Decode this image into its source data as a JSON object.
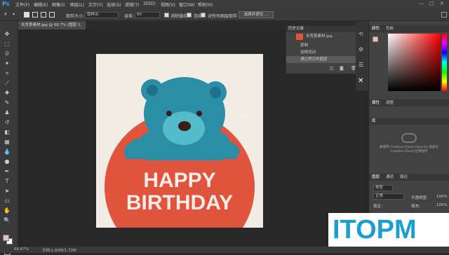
{
  "app": {
    "logo": "Ps"
  },
  "menu": {
    "items": [
      "文件(F)",
      "编辑(E)",
      "图像(I)",
      "图层(L)",
      "文字(Y)",
      "选择(S)",
      "滤镜(T)",
      "3D(D)",
      "视图(V)",
      "窗口(W)",
      "帮助(H)"
    ]
  },
  "window_controls": [
    "—",
    "□",
    "✕"
  ],
  "options": {
    "sample_size_label": "取样大小:",
    "sample_size_value": "取样点",
    "tolerance_label": "容差:",
    "tolerance_value": "60",
    "antialias_label": "消除锯齿",
    "contiguous_label": "连续",
    "sample_all_label": "对所有图层取样",
    "select_mask_button": "选择并遮住 ..."
  },
  "document": {
    "tab_title": "去背景素材.jpg @ 66.7% (图层 1, RGB/8#) *",
    "close": "×"
  },
  "history": {
    "panel_title": "历史记录",
    "snapshot_label": "去背景素材.jpg",
    "items": [
      "复制",
      "选择扭动",
      "通过拷贝的图层"
    ]
  },
  "right_panel": {
    "color_tabs": [
      "颜色",
      "色板"
    ],
    "properties_tabs": [
      "属性",
      "调整"
    ],
    "library_tabs": [
      "库"
    ],
    "cc_message": "要使用 Creative Cloud Libraries,请安装 Creative Cloud 应用程序",
    "layers_tabs": [
      "图层",
      "通道",
      "路径"
    ],
    "filter_kind": "类型",
    "blend_mode": "正常",
    "opacity_label": "不透明度:",
    "opacity_value": "100%",
    "lock_label": "锁定:",
    "fill_label": "填充:",
    "fill_value": "100%"
  },
  "artwork": {
    "line1": "HAPPY",
    "line2": "BIRTHDAY"
  },
  "status": {
    "zoom": "66.67%",
    "doc_size": "文档:1.83M/1.72M"
  },
  "watermark": {
    "text": "ITOPM"
  },
  "colors": {
    "bear": "#2a8ea6",
    "bear_snout": "#52bccb",
    "circle": "#e0543d",
    "paper": "#f2ece4",
    "watermark": "#1b9fcf"
  }
}
